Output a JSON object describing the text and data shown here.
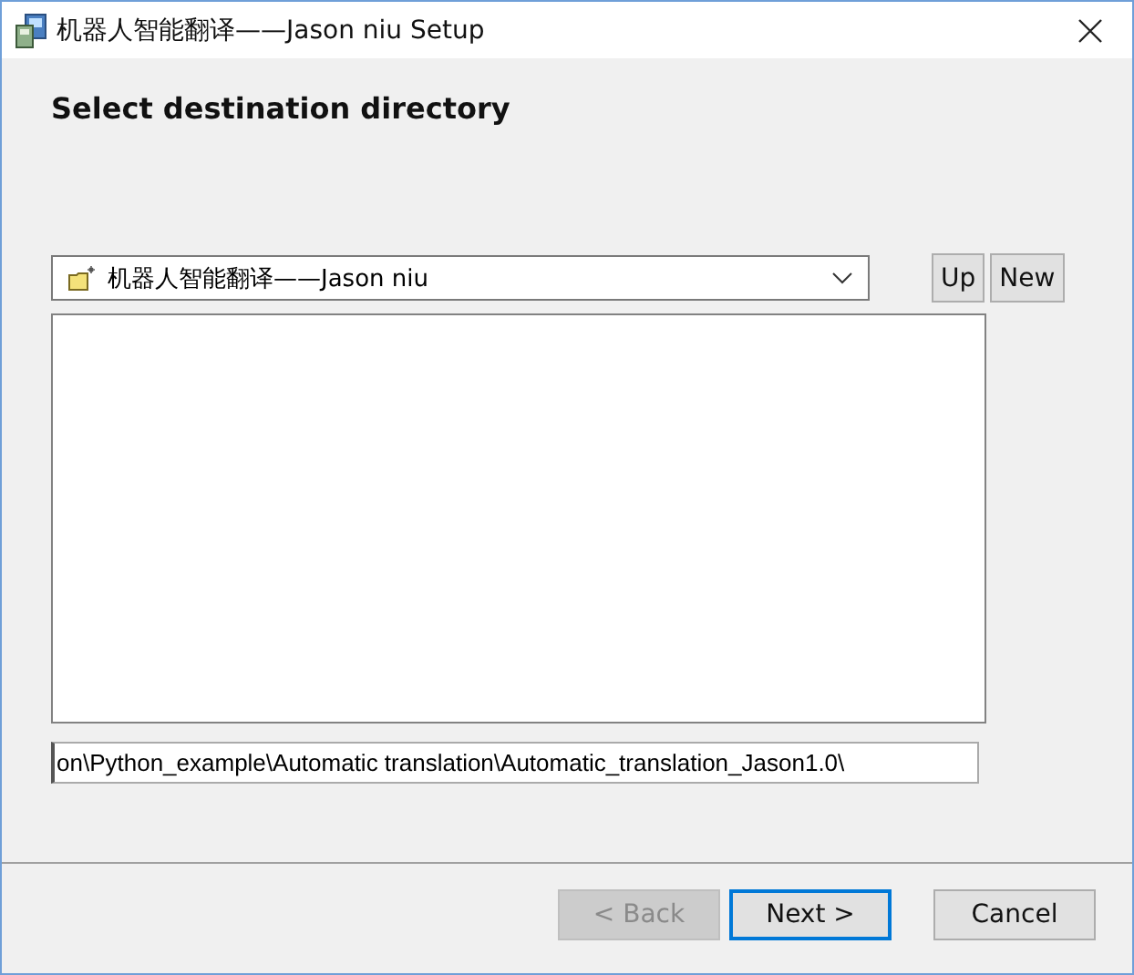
{
  "window": {
    "title": "机器人智能翻译——Jason niu Setup"
  },
  "heading": "Select destination directory",
  "folder_combo": {
    "value": "机器人智能翻译——Jason niu"
  },
  "nav_buttons": [
    {
      "label": "Up"
    },
    {
      "label": "New"
    }
  ],
  "path_field": {
    "value": "on\\Python_example\\Automatic translation\\Automatic_translation_Jason1.0\\"
  },
  "buttons": [
    {
      "label": "< Back",
      "disabled": true,
      "default": false
    },
    {
      "label": "Next >",
      "disabled": false,
      "default": true
    },
    {
      "label": "Cancel",
      "disabled": false,
      "default": false
    }
  ]
}
